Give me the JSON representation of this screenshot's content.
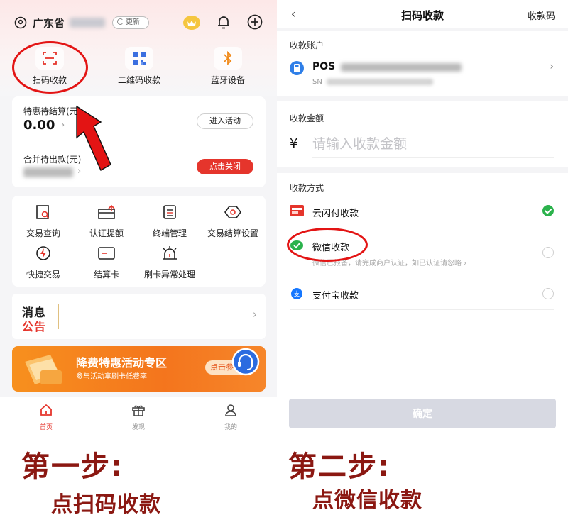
{
  "left_screen": {
    "header": {
      "province": "广东省",
      "refresh_label": "更新"
    },
    "quick_actions": [
      {
        "label": "扫码收款",
        "icon": "scan-icon"
      },
      {
        "label": "二维码收款",
        "icon": "qrcode-icon"
      },
      {
        "label": "蓝牙设备",
        "icon": "bluetooth-icon"
      }
    ],
    "settlement": {
      "label": "特惠待结算(元)",
      "amount": "0.00",
      "join_button": "进入活动",
      "merged_label": "合并待出款(元)",
      "close_button": "点击关闭"
    },
    "services": [
      {
        "label": "交易查询",
        "icon": "search-doc-icon"
      },
      {
        "label": "认证提额",
        "icon": "card-up-icon"
      },
      {
        "label": "终端管理",
        "icon": "terminal-icon"
      },
      {
        "label": "交易结算设置",
        "icon": "settings-eye-icon"
      },
      {
        "label": "快捷交易",
        "icon": "lightning-icon"
      },
      {
        "label": "结算卡",
        "icon": "card-icon"
      },
      {
        "label": "刷卡异常处理",
        "icon": "alarm-icon"
      }
    ],
    "notice": {
      "line1": "消息",
      "line2": "公告"
    },
    "banner": {
      "title": "降费特惠活动专区",
      "subtitle": "参与活动享刷卡低费率",
      "button": "点击参"
    },
    "tabbar": [
      {
        "label": "首页",
        "icon": "home-icon",
        "active": true
      },
      {
        "label": "发现",
        "icon": "gift-icon",
        "active": false
      },
      {
        "label": "我的",
        "icon": "user-icon",
        "active": false
      }
    ]
  },
  "right_screen": {
    "header": {
      "back": "‹",
      "title": "扫码收款",
      "code_link": "收款码"
    },
    "account": {
      "section_label": "收款账户",
      "pos_label": "POS",
      "sn_label": "SN"
    },
    "amount": {
      "section_label": "收款金额",
      "currency": "¥",
      "placeholder": "请输入收款金额"
    },
    "methods": {
      "section_label": "收款方式",
      "items": [
        {
          "label": "云闪付收款",
          "icon": "unionpay-icon",
          "selected": true
        },
        {
          "label": "微信收款",
          "icon": "wechat-icon",
          "selected": false,
          "note": "微信已报备，请完成商户认证，如已认证请忽略 ›"
        },
        {
          "label": "支付宝收款",
          "icon": "alipay-icon",
          "selected": false
        }
      ]
    },
    "confirm_button": "确定"
  },
  "captions": {
    "step1_title": "第一步:",
    "step1_action": "点扫码收款",
    "step2_title": "第二步:",
    "step2_action": "点微信收款"
  },
  "colors": {
    "accent_red": "#e5352c",
    "annotation_red": "#e31414",
    "caption_red": "#8b1812",
    "wechat_green": "#2bb24c",
    "banner_orange": "#f4751d"
  }
}
